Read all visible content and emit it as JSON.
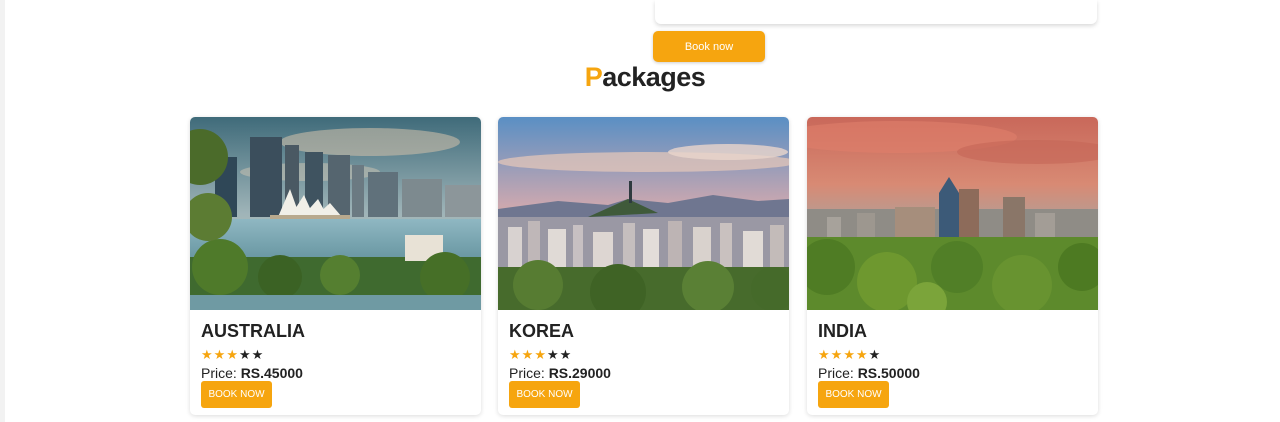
{
  "hero": {
    "book_now_label": "Book now"
  },
  "section": {
    "title_first_letter": "P",
    "title_rest": "ackages"
  },
  "packages": [
    {
      "name": "AUSTRALIA",
      "rating": 3,
      "max_rating": 5,
      "price_label": "Price:",
      "price_value": "RS.45000",
      "button_label": "BOOK NOW"
    },
    {
      "name": "KOREA",
      "rating": 3,
      "max_rating": 5,
      "price_label": "Price:",
      "price_value": "RS.29000",
      "button_label": "BOOK NOW"
    },
    {
      "name": "INDIA",
      "rating": 4,
      "max_rating": 5,
      "price_label": "Price:",
      "price_value": "RS.50000",
      "button_label": "BOOK NOW"
    }
  ],
  "colors": {
    "accent": "#f6a50f",
    "text": "#222222"
  },
  "icons": {
    "star": "star-icon"
  }
}
